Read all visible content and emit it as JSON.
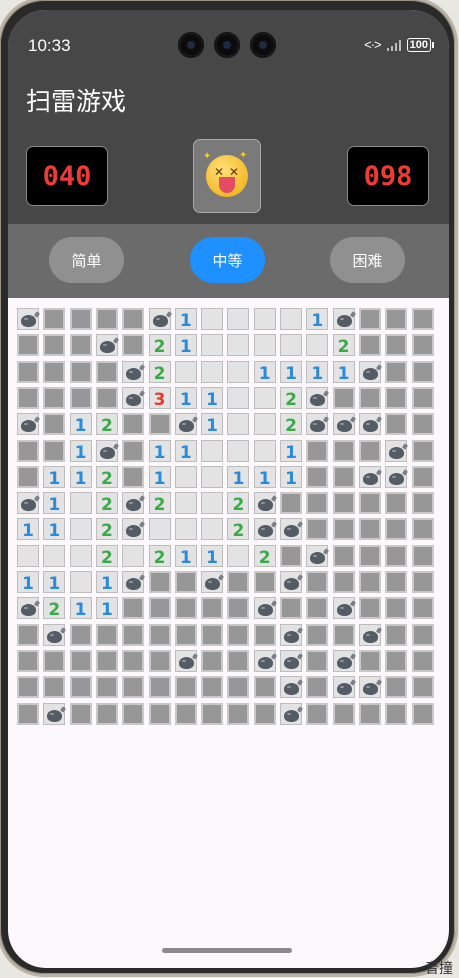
{
  "status_bar": {
    "time": "10:33",
    "battery": "100",
    "network_icon": "wifi-icon"
  },
  "app": {
    "title": "扫雷游戏"
  },
  "counters": {
    "mines_left": "040",
    "timer": "098"
  },
  "face": {
    "icon": "dizzy-face-icon",
    "state": "lost"
  },
  "difficulty": {
    "options": [
      "简单",
      "中等",
      "困难"
    ],
    "selected": "中等"
  },
  "colors": {
    "accent": "#1e90ff",
    "counter_text": "#ee3b36",
    "one": "#2a8cd8",
    "two": "#3aa948",
    "three": "#e43a2c"
  },
  "board": {
    "cols": 16,
    "rows": 16,
    "legend": "# closed, M open mine, . open empty, digit open number",
    "grid": [
      "M####M1....1M#",
      "###M#21.....2##",
      "####M2...1111M#",
      "####M311..2M###",
      "M#12##M1..2MMM#",
      "##1M#11...1###M",
      "#112#1..111##MM",
      "M1.2M2..2M#####",
      "11.2M...2MM####",
      "...2.211.2#M###",
      "11.1M##M##M####",
      "M211#####M##M##",
      "#M########M##M#",
      "######M##MM#M##",
      "##########M#MM#",
      "#M########M####"
    ]
  },
  "footer_fragment": "音撞"
}
